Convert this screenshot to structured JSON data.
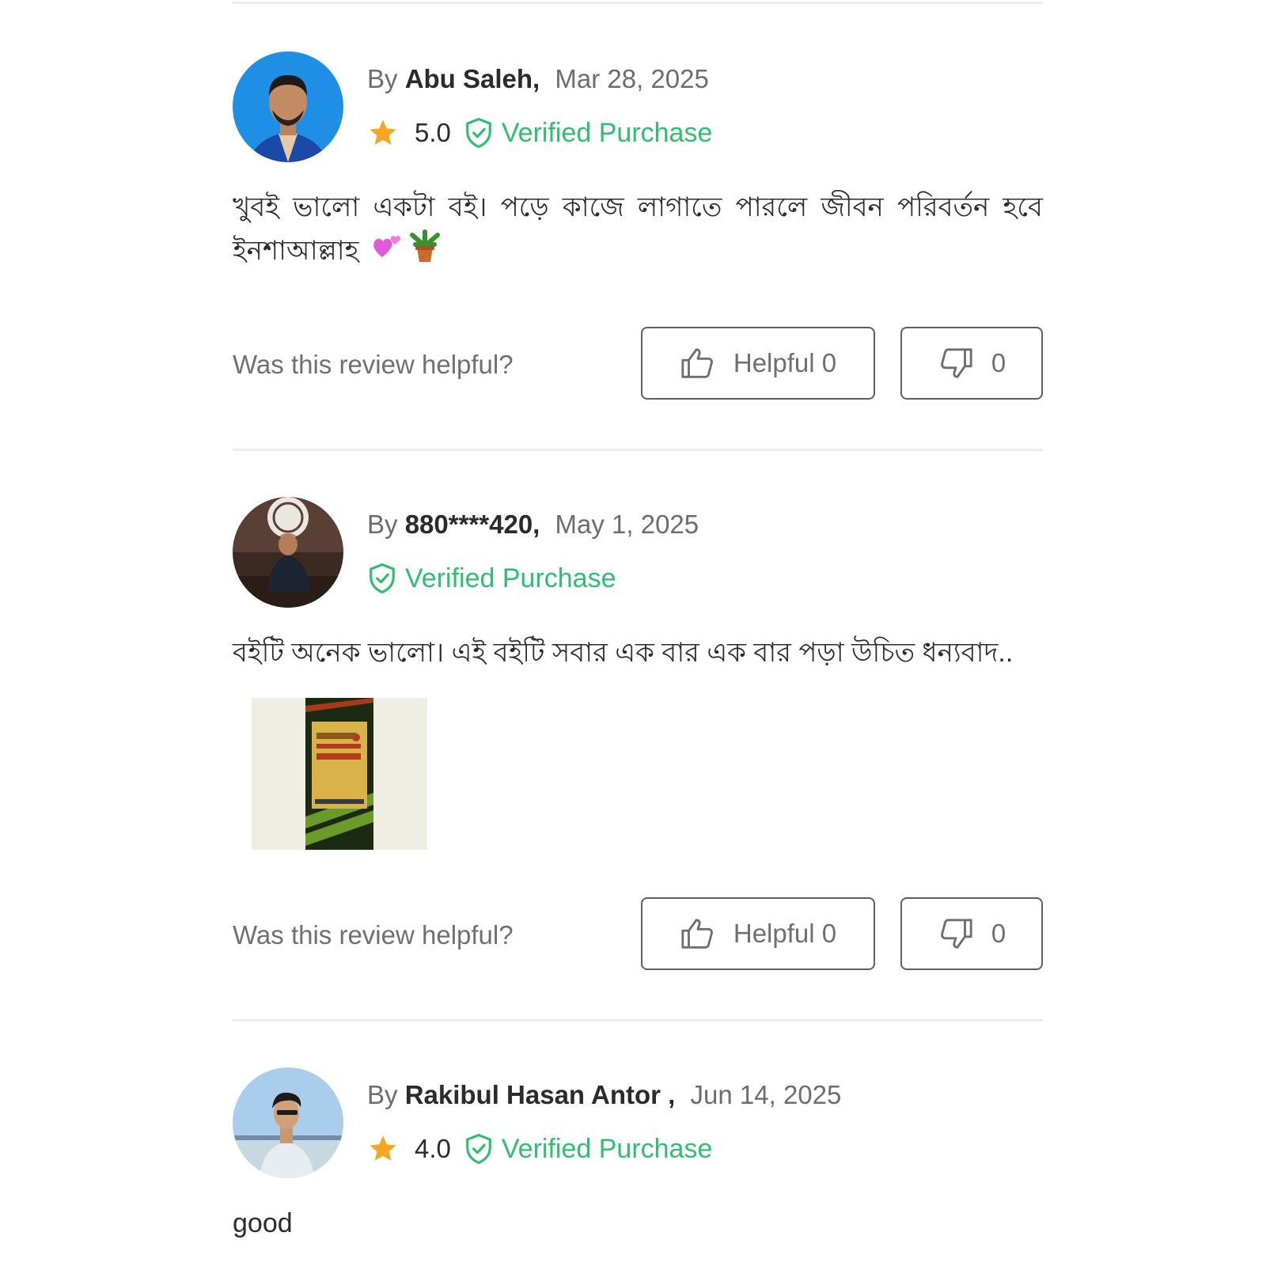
{
  "reviews": [
    {
      "by": "By",
      "author": "Abu Saleh,",
      "date": "Mar 28, 2025",
      "rating": "5.0",
      "verified": "Verified Purchase",
      "text": "খুবই ভালো একটা বই। পড়ে কাজে লাগাতে পারলে জীবন পরিবর্তন হবে ইনশাআল্লাহ",
      "emojis": [
        "two-hearts-emoji",
        "potted-plant-emoji"
      ],
      "helpful_question": "Was this review helpful?",
      "helpful_label": "Helpful 0",
      "unhelpful_count": "0"
    },
    {
      "by": "By",
      "author": "880****420,",
      "date": "May 1, 2025",
      "verified": "Verified Purchase",
      "text": "বইটি অনেক ভালো। এই বইটি সবার এক বার এক বার পড়া উচিত ধন্যবাদ..",
      "has_photo": true,
      "helpful_question": "Was this review helpful?",
      "helpful_label": "Helpful 0",
      "unhelpful_count": "0"
    },
    {
      "by": "By",
      "author": "Rakibul Hasan Antor ,",
      "date": "Jun 14, 2025",
      "rating": "4.0",
      "verified": "Verified Purchase",
      "text": "good"
    }
  ],
  "colors": {
    "verified_green": "#2fc06f",
    "star_orange": "#f5a623",
    "divider": "#ececec"
  },
  "icons": [
    "star-icon",
    "shield-check-icon",
    "thumbs-up-icon",
    "thumbs-down-icon"
  ]
}
